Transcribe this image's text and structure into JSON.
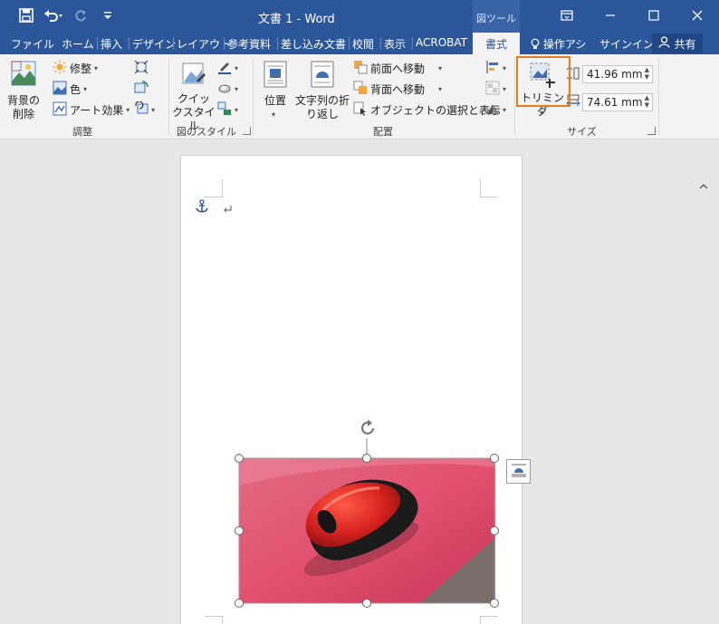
{
  "window": {
    "title": "文書 1 - Word",
    "context_group": "図ツール"
  },
  "tabs": [
    {
      "label": "ファイル"
    },
    {
      "label": "ホーム"
    },
    {
      "label": "挿入"
    },
    {
      "label": "デザイン"
    },
    {
      "label": "レイアウト"
    },
    {
      "label": "参考資料"
    },
    {
      "label": "差し込み文書"
    },
    {
      "label": "校閲"
    },
    {
      "label": "表示"
    },
    {
      "label": "ACROBAT"
    },
    {
      "label": "書式"
    }
  ],
  "tell_me": "操作アシ",
  "signin": "サインイン",
  "share": "共有",
  "ribbon": {
    "adjust": {
      "remove_bg": "背景の削除",
      "corrections": "修整",
      "color": "色",
      "artistic": "アート効果",
      "label": "調整"
    },
    "styles": {
      "quick_styles": "クイックスタイル",
      "label": "図のスタイル"
    },
    "arrange": {
      "position": "位置",
      "wrap_text": "文字列の折り返し",
      "bring_forward": "前面へ移動",
      "send_backward": "背面へ移動",
      "selection_pane": "オブジェクトの選択と表示",
      "label": "配置"
    },
    "size": {
      "crop": "トリミング",
      "height": "41.96 mm",
      "width": "74.61 mm",
      "label": "サイズ"
    }
  },
  "colors": {
    "accent": "#2b579a",
    "highlight": "#e87b22"
  }
}
